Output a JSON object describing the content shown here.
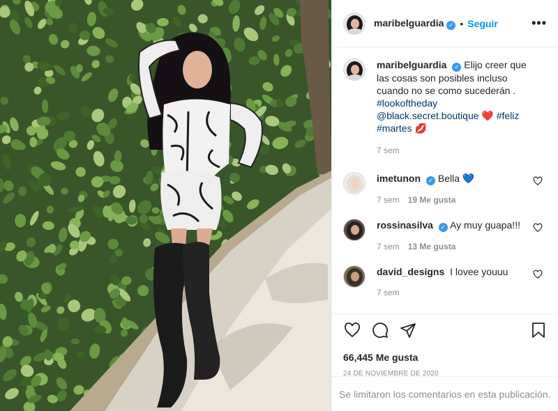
{
  "post": {
    "author": "maribelguardia",
    "follow_label": "Seguir",
    "dot": "•",
    "more_label": "•••",
    "caption": {
      "text": "Elijo creer que las cosas son posibles incluso cuando no se como sucederán .",
      "tag1": "#lookoftheday",
      "tag2": "@black.secret.boutique",
      "emoji_heart": "❤️",
      "tag3": "#feliz",
      "tag4": "#martes",
      "emoji_kiss": "💋",
      "time": "7 sem"
    },
    "comments": [
      {
        "user": "imetunon",
        "text": "Bella 💙",
        "time": "7 sem",
        "likes": "19 Me gusta",
        "verified": true
      },
      {
        "user": "rossinasilva",
        "text": "Ay muy guapa!!!",
        "time": "7 sem",
        "likes": "13 Me gusta",
        "verified": true
      },
      {
        "user": "david_designs",
        "text": "I lovee youuu",
        "time": "7 sem",
        "likes": "",
        "verified": false
      }
    ],
    "like_count": "66,445 Me gusta",
    "date": "24 DE NOVIEMBRE DE 2020",
    "comments_limited": "Se limitaron los comentarios en esta publicación."
  },
  "icons": {
    "verified": "verified-badge-icon",
    "like": "heart-icon",
    "comment": "comment-icon",
    "share": "paper-plane-icon",
    "save": "bookmark-icon"
  },
  "colors": {
    "accent": "#0095f6",
    "hashtag": "#00376b",
    "muted": "#8e8e8e",
    "border": "#efefef"
  }
}
